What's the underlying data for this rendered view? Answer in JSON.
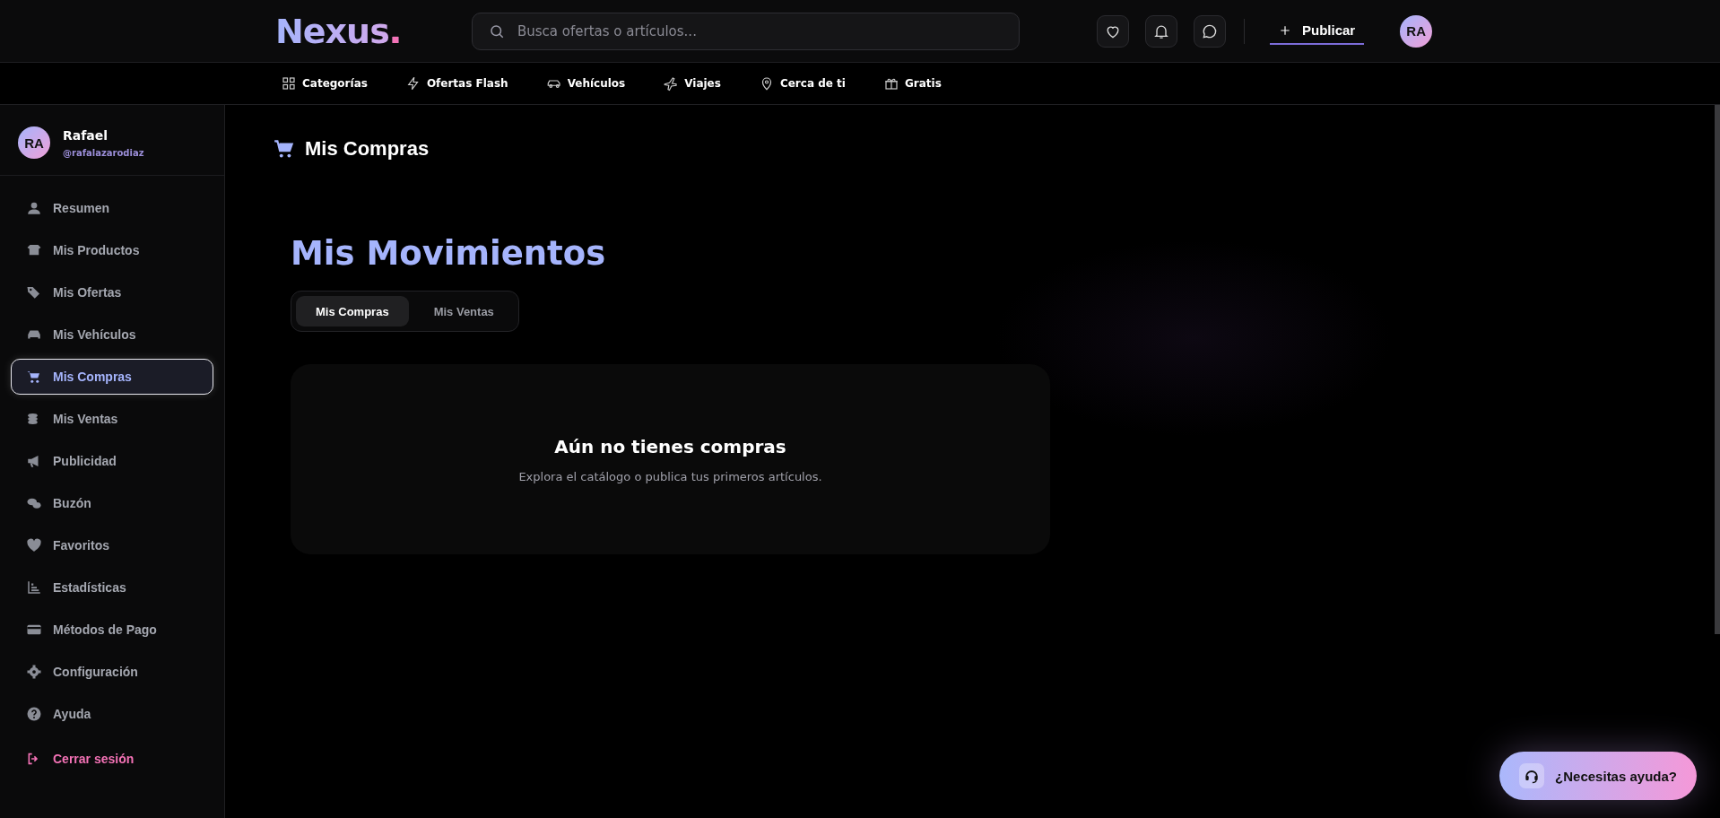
{
  "header": {
    "logo": "Nexus",
    "logo_dot": ".",
    "search": {
      "placeholder": "Busca ofertas o artículos..."
    },
    "publish_button": "Publicar",
    "avatar": "RA"
  },
  "nav": [
    {
      "label": "Categorías"
    },
    {
      "label": "Ofertas Flash"
    },
    {
      "label": "Vehículos"
    },
    {
      "label": "Viajes"
    },
    {
      "label": "Cerca de ti"
    },
    {
      "label": "Gratis"
    }
  ],
  "sidebar": {
    "profile": {
      "avatar": "RA",
      "name": "Rafael",
      "handle": "@rafalazarodiaz"
    },
    "items": [
      {
        "label": "Resumen",
        "selected": false
      },
      {
        "label": "Mis Productos",
        "selected": false
      },
      {
        "label": "Mis Ofertas",
        "selected": false
      },
      {
        "label": "Mis Vehículos",
        "selected": false
      },
      {
        "label": "Mis Compras",
        "selected": true
      },
      {
        "label": "Mis Ventas",
        "selected": false
      },
      {
        "label": "Publicidad",
        "selected": false
      },
      {
        "label": "Buzón",
        "selected": false
      },
      {
        "label": "Favoritos",
        "selected": false
      },
      {
        "label": "Estadísticas",
        "selected": false
      },
      {
        "label": "Métodos de Pago",
        "selected": false
      },
      {
        "label": "Configuración",
        "selected": false
      },
      {
        "label": "Ayuda",
        "selected": false
      }
    ],
    "logout": "Cerrar sesión"
  },
  "main": {
    "page_title": "Mis Compras",
    "heading": "Mis Movimientos",
    "tabs": [
      {
        "label": "Mis Compras",
        "selected": true
      },
      {
        "label": "Mis Ventas",
        "selected": false
      }
    ],
    "empty_state": {
      "title": "Aún no tienes compras",
      "text": "Explora el catálogo o publica tus primeros artículos."
    }
  },
  "help_button": "¿Necesitas ayuda?"
}
